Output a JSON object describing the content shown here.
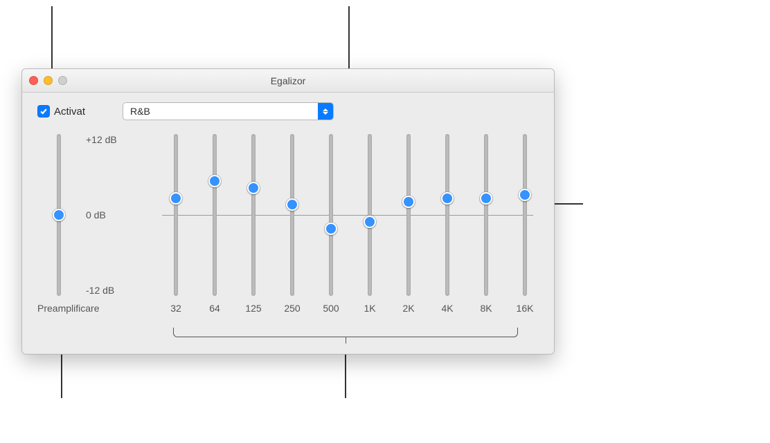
{
  "window": {
    "title": "Egalizor"
  },
  "activate": {
    "label": "Activat",
    "checked": true
  },
  "preset": {
    "value": "R&B"
  },
  "db_scale": {
    "max": "+12 dB",
    "mid": "0 dB",
    "min": "-12 dB"
  },
  "preamp": {
    "label": "Preamplificare",
    "value_db": 0
  },
  "bands": [
    {
      "freq": "32",
      "value_db": 2.5
    },
    {
      "freq": "64",
      "value_db": 5.0
    },
    {
      "freq": "125",
      "value_db": 4.0
    },
    {
      "freq": "250",
      "value_db": 1.5
    },
    {
      "freq": "500",
      "value_db": -2.0
    },
    {
      "freq": "1K",
      "value_db": -1.0
    },
    {
      "freq": "2K",
      "value_db": 2.0
    },
    {
      "freq": "4K",
      "value_db": 2.5
    },
    {
      "freq": "8K",
      "value_db": 2.5
    },
    {
      "freq": "16K",
      "value_db": 3.0
    }
  ]
}
